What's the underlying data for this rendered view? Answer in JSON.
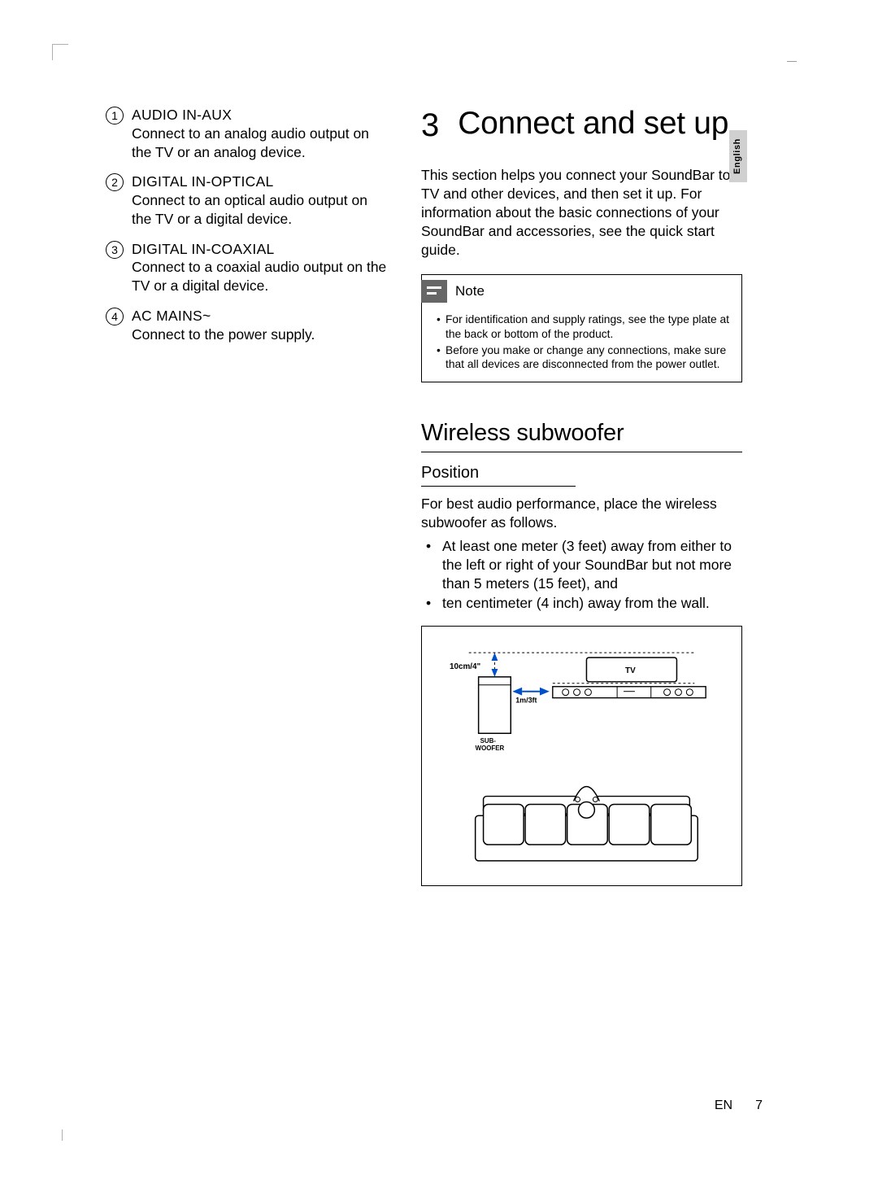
{
  "left_column": {
    "items": [
      {
        "num": "1",
        "title": "AUDIO IN-AUX",
        "desc": "Connect to an analog audio output on the TV or an analog device."
      },
      {
        "num": "2",
        "title": "DIGITAL IN-OPTICAL",
        "desc": "Connect to an optical audio output on the TV or a digital device."
      },
      {
        "num": "3",
        "title": "DIGITAL IN-COAXIAL",
        "desc": "Connect to a coaxial audio output on the TV or a digital device."
      },
      {
        "num": "4",
        "title": "AC MAINS~",
        "desc": "Connect to the power supply."
      }
    ]
  },
  "right_column": {
    "chapter_num": "3",
    "chapter_title": "Connect and set up",
    "language_tab": "English",
    "intro": "This section helps you connect your SoundBar to a TV and other devices, and then set it up. For information about the basic connections of your SoundBar and accessories, see the quick start guide.",
    "note": {
      "label": "Note",
      "items": [
        "For identification and supply ratings, see the type plate at the back or bottom of the product.",
        "Before you make or change any connections, make sure that all devices are disconnected from the power outlet."
      ]
    },
    "section_h2": "Wireless subwoofer",
    "section_h3": "Position",
    "position_intro": "For best audio performance, place the wireless subwoofer as follows.",
    "position_bullets": [
      "At least one meter (3 feet) away from either to the left or right of your SoundBar but not more than 5 meters (15 feet), and",
      "ten centimeter (4 inch) away from the wall."
    ],
    "diagram": {
      "wall_dist": "10cm/4\"",
      "horiz_dist": "1m/3ft",
      "tv_label": "TV",
      "sub_label": "SUB-\nWOOFER"
    }
  },
  "footer": {
    "lang": "EN",
    "page": "7"
  }
}
